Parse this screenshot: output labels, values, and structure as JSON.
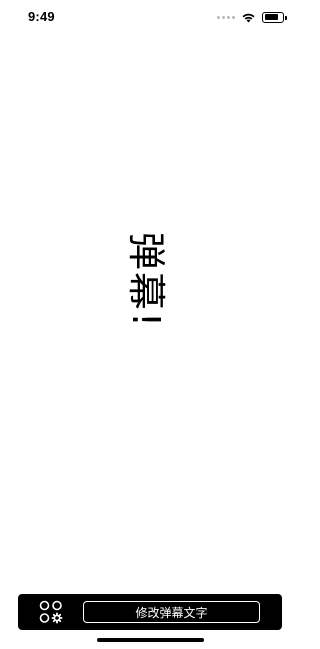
{
  "status_bar": {
    "time": "9:49",
    "battery_level": 0.85
  },
  "danmaku": {
    "text": "弹幕!"
  },
  "toolbar": {
    "apps_icon": "apps-settings-icon",
    "edit_button_label": "修改弹幕文字"
  },
  "colors": {
    "background": "#ffffff",
    "toolbar": "#000000",
    "text": "#000000"
  }
}
